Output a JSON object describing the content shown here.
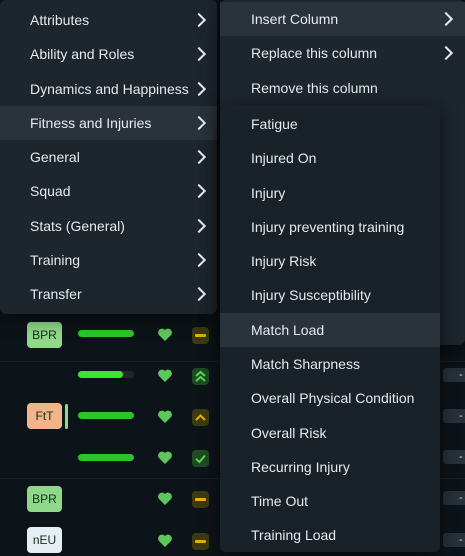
{
  "left_menu": {
    "items": [
      {
        "label": "Attributes"
      },
      {
        "label": "Ability and Roles"
      },
      {
        "label": "Dynamics and Happiness"
      },
      {
        "label": "Fitness and Injuries"
      },
      {
        "label": "General"
      },
      {
        "label": "Squad"
      },
      {
        "label": "Stats (General)"
      },
      {
        "label": "Training"
      },
      {
        "label": "Transfer"
      }
    ],
    "highlighted": "Fitness and Injuries"
  },
  "column_menu": {
    "items": [
      {
        "label": "Insert Column"
      },
      {
        "label": "Replace this column"
      },
      {
        "label": "Remove this column"
      }
    ]
  },
  "submenu": {
    "items": [
      {
        "label": "Fatigue"
      },
      {
        "label": "Injured On"
      },
      {
        "label": "Injury"
      },
      {
        "label": "Injury preventing training"
      },
      {
        "label": "Injury Risk"
      },
      {
        "label": "Injury Susceptibility"
      },
      {
        "label": "Match Load"
      },
      {
        "label": "Match Sharpness"
      },
      {
        "label": "Overall Physical Condition"
      },
      {
        "label": "Overall Risk"
      },
      {
        "label": "Recurring Injury"
      },
      {
        "label": "Time Out"
      },
      {
        "label": "Training Load"
      }
    ],
    "highlighted": "Match Load"
  },
  "table_rows": [
    {
      "badge": "BPR",
      "badge_color": "#8fd88a",
      "bar_fill": 1.0,
      "status": "neutral"
    },
    {
      "badge": "",
      "badge_color": "",
      "bar_fill": 0.8,
      "status": "double-up"
    },
    {
      "badge": "FtT",
      "badge_color": "#f2b58a",
      "bar_fill": 1.0,
      "status": "up"
    },
    {
      "badge": "",
      "badge_color": "",
      "bar_fill": 1.0,
      "status": "check"
    },
    {
      "badge": "BPR",
      "badge_color": "#8fd88a",
      "bar_fill": 0.0,
      "status": "neutral"
    },
    {
      "badge": "nEU",
      "badge_color": "#e4eef4",
      "bar_fill": 0.0,
      "status": "neutral"
    }
  ],
  "right_cells": [
    "-",
    "-",
    "-",
    "-",
    "-",
    "-"
  ],
  "colors": {
    "background": "#0d1419",
    "menu": "#1d252d",
    "menu_highlight": "#2a333c",
    "bar": "#2cc32c",
    "heart": "#5dc85a",
    "status_neutral": "#e8b100"
  }
}
